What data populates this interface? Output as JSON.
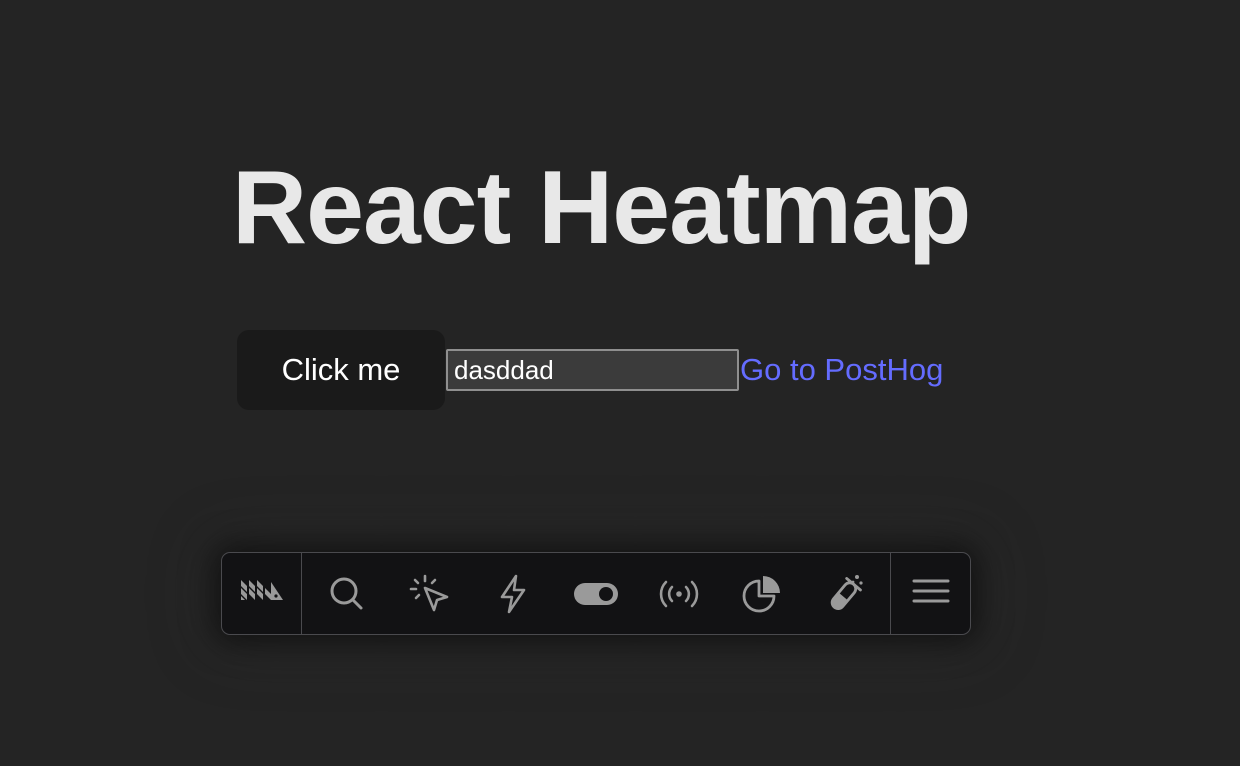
{
  "page": {
    "title": "React Heatmap"
  },
  "form": {
    "button_label": "Click me",
    "input_value": "dasddad",
    "link_text": "Go to PostHog"
  },
  "toolbar": {
    "logo_icon": "posthog-logo-icon",
    "tools": [
      {
        "name": "search-icon"
      },
      {
        "name": "pointer-click-icon"
      },
      {
        "name": "lightning-icon"
      },
      {
        "name": "toggle-icon"
      },
      {
        "name": "broadcast-icon"
      },
      {
        "name": "pie-chart-icon"
      },
      {
        "name": "flask-icon"
      }
    ],
    "menu_icon": "hamburger-menu-icon"
  },
  "colors": {
    "background": "#242424",
    "link": "#646cff",
    "toolbar_bg": "#121214",
    "icon": "#9a9a9a"
  }
}
